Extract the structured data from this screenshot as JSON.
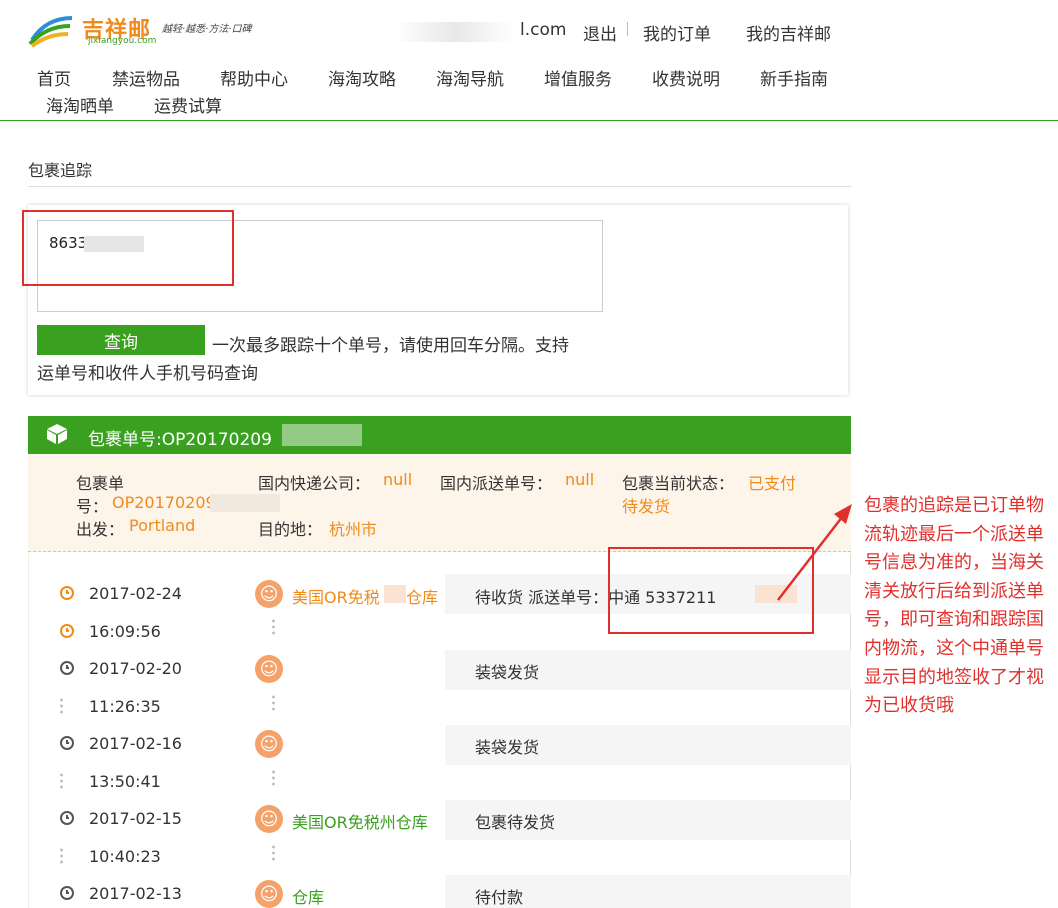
{
  "brand": {
    "name": "吉祥邮",
    "domain": "jixiangyou.com",
    "slogan": "越轻·越悉·方法·口碑",
    "colors": {
      "green": "#3aa020",
      "orange": "#f08a1a",
      "red": "#e0302c"
    }
  },
  "header": {
    "user_email": "l.com",
    "logout": "退出",
    "my_orders": "我的订单",
    "my_account": "我的吉祥邮"
  },
  "nav": [
    "首页",
    "禁运物品",
    "帮助中心",
    "海淘攻略",
    "海淘导航",
    "增值服务",
    "收费说明",
    "新手指南",
    "海淘晒单",
    "运费试算"
  ],
  "page": {
    "section_title": "包裹追踪"
  },
  "search": {
    "value": "8633        1CN",
    "button": "查询",
    "hint_line1": "一次最多跟踪十个单号，请使用回车分隔。支持",
    "hint_line2": "运单号和收件人手机号码查询"
  },
  "package": {
    "header": "包裹单号:OP20170209",
    "labels": {
      "pkg_no_l1": "包裹单",
      "pkg_no_l2": "号：",
      "courier": "国内快递公司：",
      "dispatch_no": "国内派送单号：",
      "status": "包裹当前状态：",
      "origin": "出发：",
      "dest": "目的地："
    },
    "pkg_no": "OP201702091",
    "courier": "null",
    "dispatch_no": "null",
    "status_l1": "已支付",
    "status_l2": "待发货",
    "origin": "Portland",
    "dest": "杭州市"
  },
  "timeline": [
    {
      "date": "2017-02-24",
      "time": "16:09:56",
      "place": "美国OR免税",
      "place_tail": "仓库",
      "status": "待收货 派送单号：中通 5337211",
      "highlight": true
    },
    {
      "date": "2017-02-20",
      "time": "11:26:35",
      "place": "",
      "place_tail": "",
      "status": "装袋发货",
      "highlight": false
    },
    {
      "date": "2017-02-16",
      "time": "13:50:41",
      "place": "",
      "place_tail": "",
      "status": "装袋发货",
      "highlight": false
    },
    {
      "date": "2017-02-15",
      "time": "10:40:23",
      "place": "美国OR免税州仓库",
      "place_tail": "",
      "status": "包裹待发货",
      "highlight": false
    },
    {
      "date": "2017-02-13",
      "time": "",
      "place": "仓库",
      "place_tail": "",
      "status": "待付款",
      "highlight": false
    }
  ],
  "annotation": "包裹的追踪是已订单物流轨迹最后一个派送单号信息为准的，当海关清关放行后给到派送单号，即可查询和跟踪国内物流，这个中通单号显示目的地签收了才视为已收货哦"
}
